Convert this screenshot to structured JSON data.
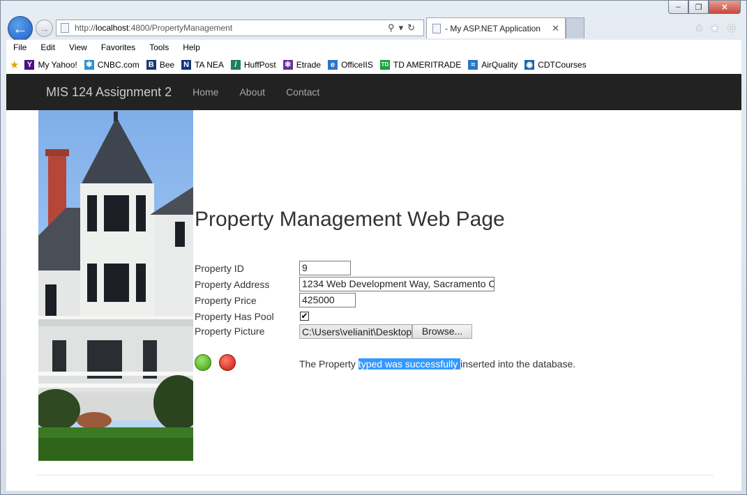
{
  "browser": {
    "url_prefix": "http://",
    "url_host": "localhost",
    "url_rest": ":4800/PropertyManagement",
    "tab_title": "- My ASP.NET Application",
    "tab_close": "✕",
    "back_glyph": "←",
    "forward_glyph": "→",
    "window_controls": [
      "–",
      "❐",
      "✕"
    ],
    "right_icons": [
      "home-icon",
      "star-icon",
      "gear-icon"
    ]
  },
  "menu": [
    "File",
    "Edit",
    "View",
    "Favorites",
    "Tools",
    "Help"
  ],
  "favorites": [
    {
      "label": "My Yahoo!",
      "icon": "yahoo-icon",
      "color": "#4b0f87",
      "glyph": "Y"
    },
    {
      "label": "CNBC.com",
      "icon": "cnbc-icon",
      "color": "#2f8fd0",
      "glyph": "✱"
    },
    {
      "label": "Bee",
      "icon": "bee-icon",
      "color": "#163a75",
      "glyph": "B"
    },
    {
      "label": "TA NEA",
      "icon": "ta-nea-icon",
      "color": "#13357a",
      "glyph": "N"
    },
    {
      "label": "HuffPost",
      "icon": "huffpost-icon",
      "color": "#1d7f62",
      "glyph": "/"
    },
    {
      "label": "Etrade",
      "icon": "etrade-icon",
      "color": "#6b2fa0",
      "glyph": "✻"
    },
    {
      "label": "OfficeIIS",
      "icon": "ie-icon",
      "color": "#2a77c9",
      "glyph": "e"
    },
    {
      "label": "TD AMERITRADE",
      "icon": "td-icon",
      "color": "#15a33a",
      "glyph": "TD"
    },
    {
      "label": "AirQuality",
      "icon": "airquality-icon",
      "color": "#2a78c2",
      "glyph": "≈"
    },
    {
      "label": "CDTCourses",
      "icon": "cdt-icon",
      "color": "#1a66b0",
      "glyph": "◉"
    }
  ],
  "site": {
    "brand": "MIS 124 Assignment 2",
    "nav": [
      "Home",
      "About",
      "Contact"
    ]
  },
  "page": {
    "heading": "Property Management Web Page",
    "labels": {
      "id": "Property ID",
      "address": "Property Address",
      "price": "Property Price",
      "pool": "Property Has Pool",
      "picture": "Property Picture"
    },
    "values": {
      "id": "9",
      "address": "1234 Web Development Way, Sacramento C",
      "price": "425000",
      "pool_checked": true,
      "pool_mark": "✔",
      "picture_path": "C:\\Users\\velianit\\Desktop"
    },
    "browse_label": "Browse...",
    "status_before": "The Property ",
    "status_selected": "typed was successfully ",
    "status_after": "inserted into the database."
  }
}
